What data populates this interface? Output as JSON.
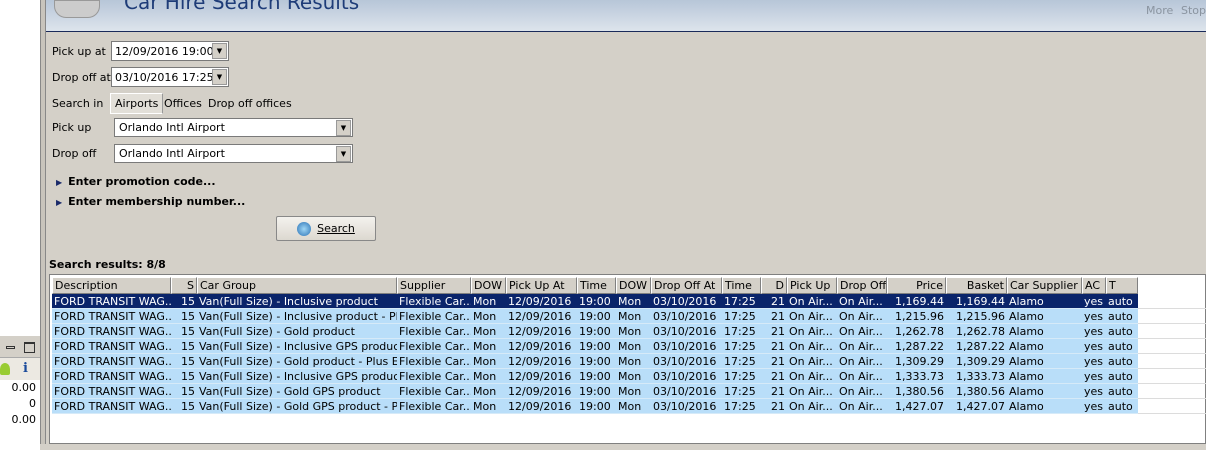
{
  "header": {
    "title": "Car Hire Search Results",
    "more": "More",
    "stop": "Stop"
  },
  "form": {
    "pickup_at_label": "Pick up at",
    "pickup_at": "12/09/2016 19:00",
    "dropoff_at_label": "Drop off at",
    "dropoff_at": "03/10/2016 17:25",
    "search_in_label": "Search in",
    "tabs": [
      "Airports",
      "Offices",
      "Drop off offices"
    ],
    "pickup_label": "Pick up",
    "pickup": "Orlando Intl Airport",
    "dropoff_label": "Drop off",
    "dropoff": "Orlando Intl Airport",
    "promo": "Enter promotion code...",
    "membership": "Enter membership number...",
    "search_button": "Search"
  },
  "results": {
    "label": "Search results: 8/8",
    "columns": [
      "Description",
      "S",
      "Car Group",
      "Supplier",
      "DOW",
      "Pick Up At",
      "Time",
      "DOW",
      "Drop Off At",
      "Time",
      "D",
      "Pick Up",
      "Drop Off",
      "Price",
      "Basket",
      "Car Supplier",
      "AC",
      "T"
    ],
    "rows": [
      [
        "FORD TRANSIT WAG...",
        "15",
        "Van(Full Size) - Inclusive product",
        "Flexible Car...",
        "Mon",
        "12/09/2016",
        "19:00",
        "Mon",
        "03/10/2016",
        "17:25",
        "21",
        "On Air...",
        "On Air...",
        "1,169.44",
        "1,169.44",
        "Alamo",
        "yes",
        "auto"
      ],
      [
        "FORD TRANSIT WAG...",
        "15",
        "Van(Full Size) - Inclusive product - Plu...",
        "Flexible Car...",
        "Mon",
        "12/09/2016",
        "19:00",
        "Mon",
        "03/10/2016",
        "17:25",
        "21",
        "On Air...",
        "On Air...",
        "1,215.96",
        "1,215.96",
        "Alamo",
        "yes",
        "auto"
      ],
      [
        "FORD TRANSIT WAG...",
        "15",
        "Van(Full Size) - Gold product",
        "Flexible Car...",
        "Mon",
        "12/09/2016",
        "19:00",
        "Mon",
        "03/10/2016",
        "17:25",
        "21",
        "On Air...",
        "On Air...",
        "1,262.78",
        "1,262.78",
        "Alamo",
        "yes",
        "auto"
      ],
      [
        "FORD TRANSIT WAG...",
        "15",
        "Van(Full Size) - Inclusive GPS product",
        "Flexible Car...",
        "Mon",
        "12/09/2016",
        "19:00",
        "Mon",
        "03/10/2016",
        "17:25",
        "21",
        "On Air...",
        "On Air...",
        "1,287.22",
        "1,287.22",
        "Alamo",
        "yes",
        "auto"
      ],
      [
        "FORD TRANSIT WAG...",
        "15",
        "Van(Full Size) - Gold product - Plus Ex...",
        "Flexible Car...",
        "Mon",
        "12/09/2016",
        "19:00",
        "Mon",
        "03/10/2016",
        "17:25",
        "21",
        "On Air...",
        "On Air...",
        "1,309.29",
        "1,309.29",
        "Alamo",
        "yes",
        "auto"
      ],
      [
        "FORD TRANSIT WAG...",
        "15",
        "Van(Full Size) - Inclusive GPS product ...",
        "Flexible Car...",
        "Mon",
        "12/09/2016",
        "19:00",
        "Mon",
        "03/10/2016",
        "17:25",
        "21",
        "On Air...",
        "On Air...",
        "1,333.73",
        "1,333.73",
        "Alamo",
        "yes",
        "auto"
      ],
      [
        "FORD TRANSIT WAG...",
        "15",
        "Van(Full Size) - Gold GPS product",
        "Flexible Car...",
        "Mon",
        "12/09/2016",
        "19:00",
        "Mon",
        "03/10/2016",
        "17:25",
        "21",
        "On Air...",
        "On Air...",
        "1,380.56",
        "1,380.56",
        "Alamo",
        "yes",
        "auto"
      ],
      [
        "FORD TRANSIT WAG...",
        "15",
        "Van(Full Size) - Gold GPS product - Plu...",
        "Flexible Car...",
        "Mon",
        "12/09/2016",
        "19:00",
        "Mon",
        "03/10/2016",
        "17:25",
        "21",
        "On Air...",
        "On Air...",
        "1,427.07",
        "1,427.07",
        "Alamo",
        "yes",
        "auto"
      ]
    ],
    "selected_row": 0
  },
  "left_panel": {
    "values": [
      "0.00",
      "0",
      "0.00"
    ],
    "info_icon": "i"
  },
  "colors": {
    "selection": "#0a246a",
    "row": "#b9def9"
  }
}
